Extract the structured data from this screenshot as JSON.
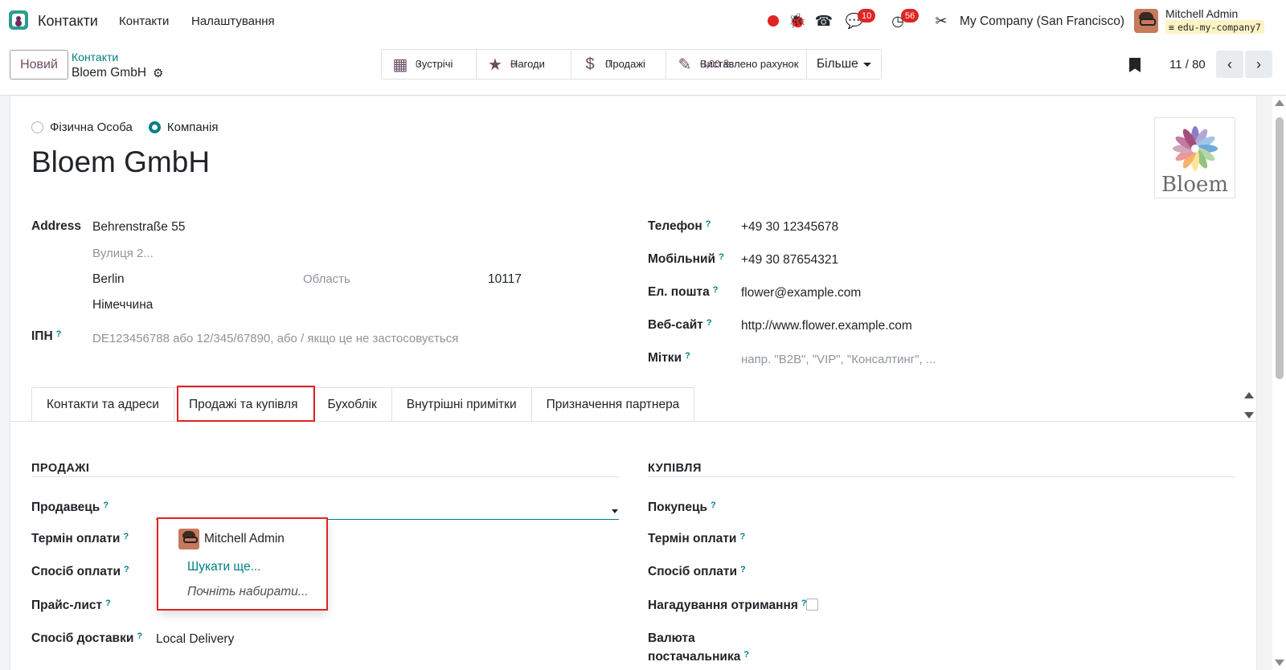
{
  "navbar": {
    "app_name": "Контакти",
    "menu": [
      "Контакти",
      "Налаштування"
    ],
    "chat_badge": "10",
    "activity_badge": "56",
    "company": "My Company (San Francisco)",
    "user_name": "Mitchell Admin",
    "database": "edu-my-company7"
  },
  "control": {
    "new_label": "Новий",
    "breadcrumb_parent": "Контакти",
    "breadcrumb_current": "Bloem GmbH",
    "smart_buttons": [
      {
        "label": "Зустрічі",
        "value": "0",
        "icon": "calendar-icon"
      },
      {
        "label": "Нагоди",
        "value": "0",
        "icon": "star-icon"
      },
      {
        "label": "Продажі",
        "value": "0",
        "icon": "dollar-icon"
      },
      {
        "label": "Виставлено рахунок",
        "value": "0,00 ₴",
        "icon": "invoice-icon"
      }
    ],
    "more_label": "Більше",
    "pager": "11 / 80"
  },
  "form": {
    "type_individual": "Фізична Особа",
    "type_company": "Компанія",
    "name": "Bloem GmbH",
    "logo_text": "Bloem",
    "address_label": "Address",
    "street": "Behrenstraße 55",
    "street2_placeholder": "Вулиця 2...",
    "city": "Berlin",
    "state_placeholder": "Область",
    "zip": "10117",
    "country": "Німеччина",
    "vat_label": "ІПН",
    "vat_placeholder": "DE123456788 або 12/345/67890, або / якщо це не застосовується",
    "phone_label": "Телефон",
    "phone": "+49 30 12345678",
    "mobile_label": "Мобільний",
    "mobile": "+49 30 87654321",
    "email_label": "Ел. пошта",
    "email": "flower@example.com",
    "website_label": "Веб-сайт",
    "website": "http://www.flower.example.com",
    "tags_label": "Мітки",
    "tags_placeholder": "напр. \"B2B\", \"VIP\", \"Консалтинг\", ...",
    "help_mark": "?"
  },
  "tabs": [
    "Контакти та адреси",
    "Продажі та купівля",
    "Бухоблік",
    "Внутрішні примітки",
    "Призначення партнера"
  ],
  "sales": {
    "title": "ПРОДАЖІ",
    "salesperson": "Продавець",
    "payment_terms": "Термін оплати",
    "payment_method": "Спосіб оплати",
    "pricelist": "Прайс-лист",
    "delivery_method": "Спосіб доставки",
    "delivery_value": "Local Delivery"
  },
  "purchase": {
    "title": "КУПІВЛЯ",
    "buyer": "Покупець",
    "payment_terms": "Термін оплати",
    "payment_method": "Спосіб оплати",
    "receipt_reminder": "Нагадування отримання",
    "vendor_currency_1": "Валюта",
    "vendor_currency_2": "постачальника"
  },
  "dropdown": {
    "option_user": "Mitchell Admin",
    "search_more": "Шукати ще...",
    "start_typing": "Почніть набирати..."
  },
  "colors": {
    "brand": "#714b67",
    "accent": "#017e84",
    "highlight": "#e02424"
  }
}
